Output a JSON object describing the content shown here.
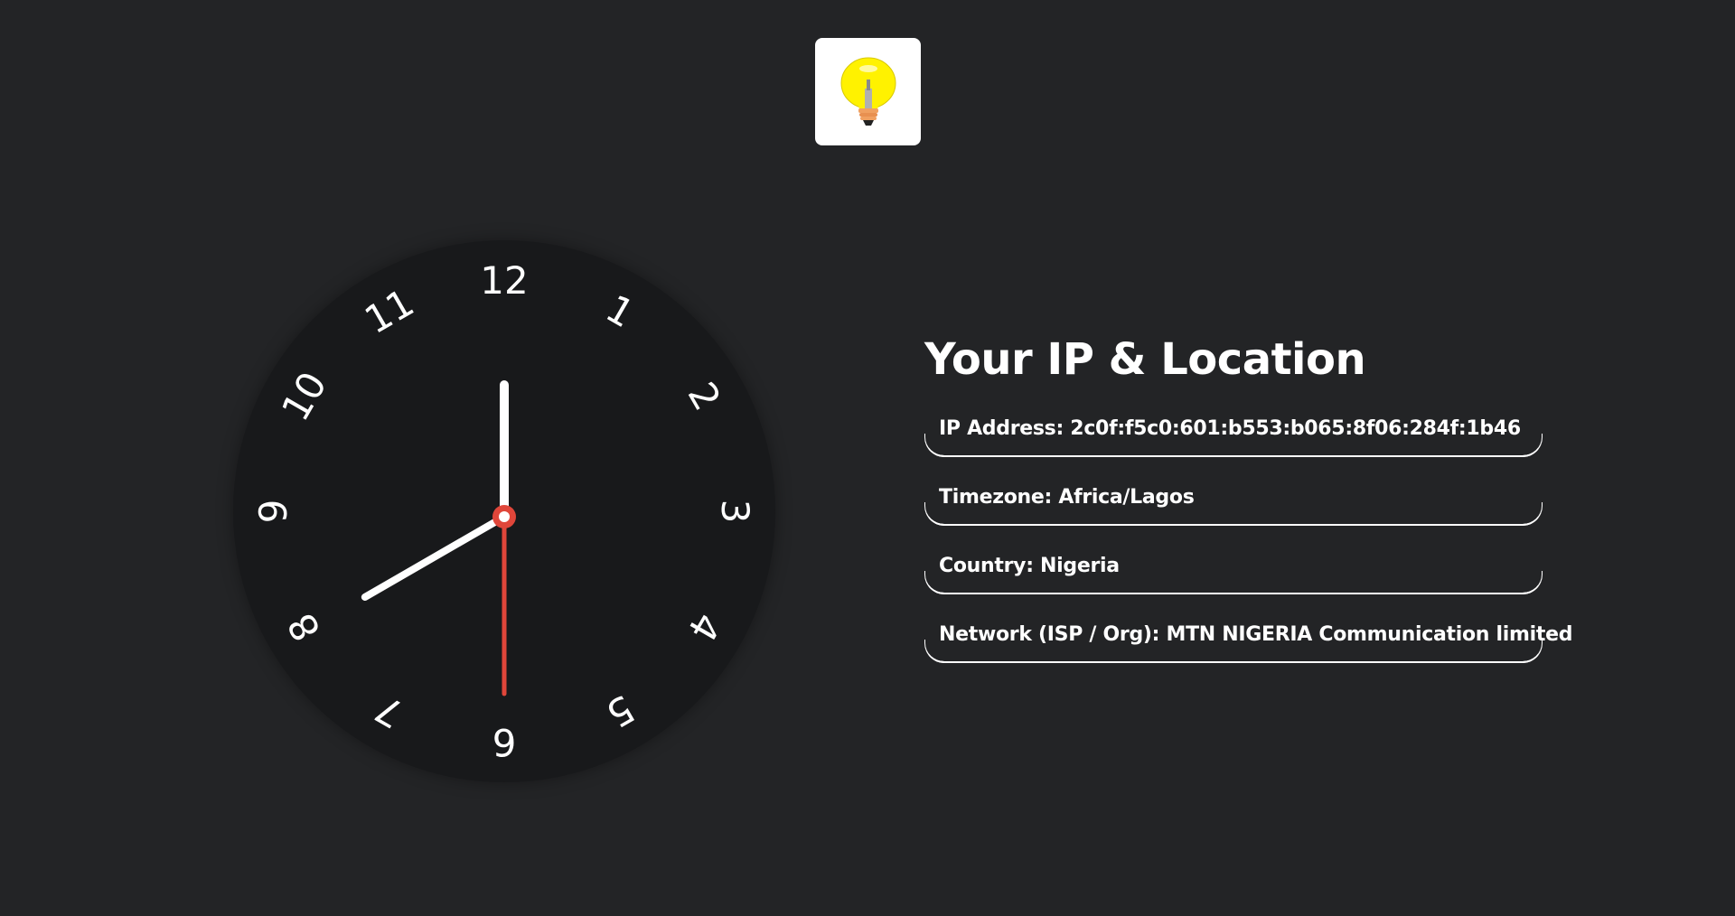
{
  "logo": {
    "icon": "light-bulb-icon",
    "background": "#ffffff",
    "bulb_color": "#fff200"
  },
  "clock": {
    "numbers": [
      "12",
      "1",
      "2",
      "3",
      "4",
      "5",
      "6",
      "7",
      "8",
      "9",
      "10",
      "11"
    ],
    "time_shown": {
      "hour": 8,
      "minute": 0,
      "second": 30
    },
    "face_color": "#18191b",
    "hand_color": "#ffffff",
    "second_hand_color": "#e0463a"
  },
  "info": {
    "title": "Your IP & Location",
    "rows": [
      {
        "label": "IP Address",
        "value": "2c0f:f5c0:601:b553:b065:8f06:284f:1b46",
        "text": "IP Address: 2c0f:f5c0:601:b553:b065:8f06:284f:1b46"
      },
      {
        "label": "Timezone",
        "value": "Africa/Lagos",
        "text": "Timezone: Africa/Lagos"
      },
      {
        "label": "Country",
        "value": "Nigeria",
        "text": "Country: Nigeria"
      },
      {
        "label": "Network (ISP / Org)",
        "value": "MTN NIGERIA Communication limited",
        "text": "Network (ISP / Org): MTN NIGERIA Communication limited"
      }
    ]
  },
  "colors": {
    "background": "#232426",
    "text": "#ffffff"
  }
}
